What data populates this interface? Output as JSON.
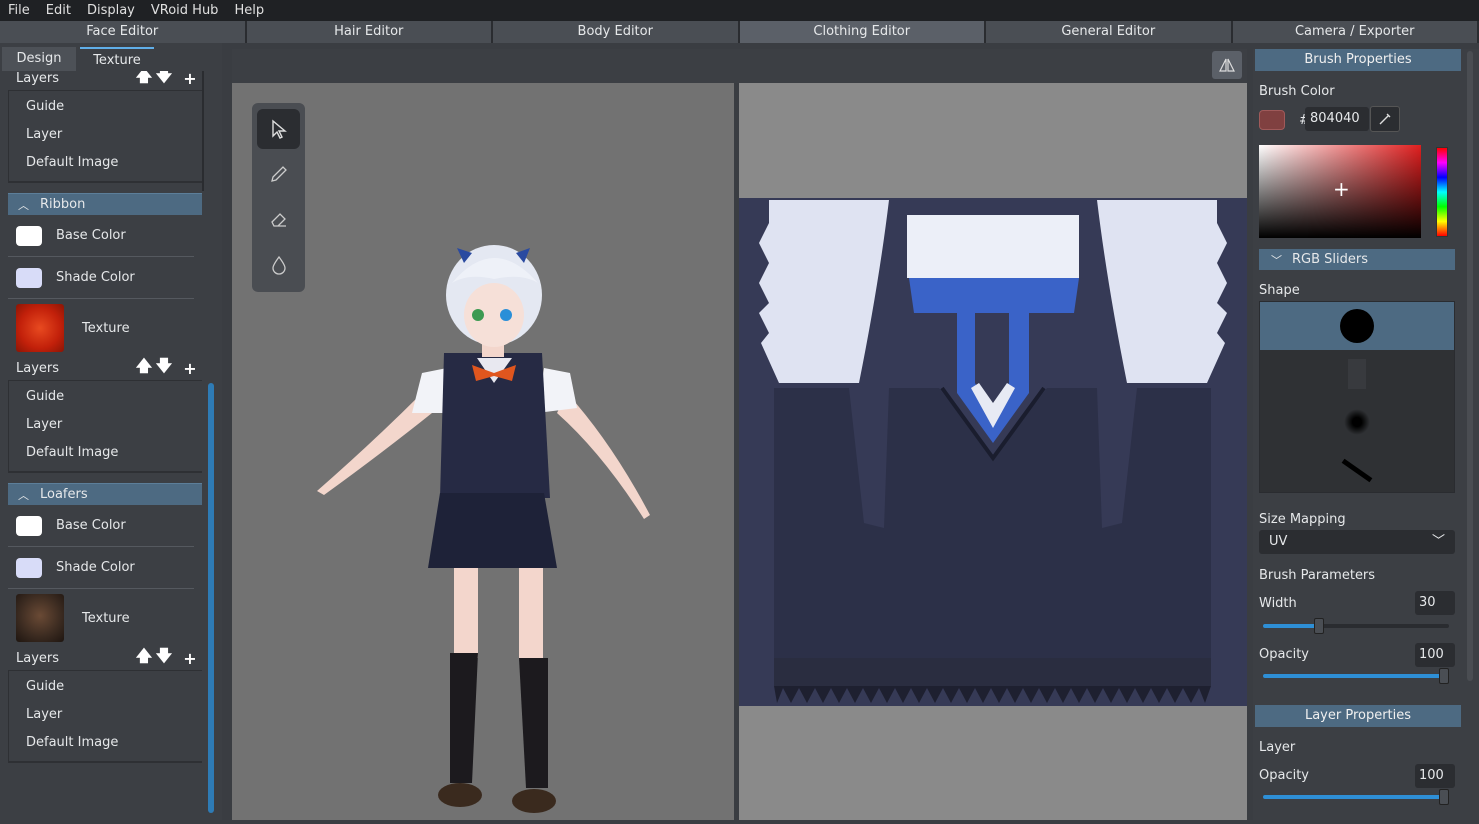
{
  "menu": [
    "File",
    "Edit",
    "Display",
    "VRoid Hub",
    "Help"
  ],
  "editor_tabs": [
    "Face Editor",
    "Hair Editor",
    "Body Editor",
    "Clothing Editor",
    "General Editor",
    "Camera / Exporter"
  ],
  "left": {
    "tabs": [
      "Design",
      "Texture"
    ],
    "layers_label": "Layers",
    "layer_items": [
      "Guide",
      "Layer",
      "Default Image"
    ],
    "sections": [
      {
        "title": "Ribbon",
        "base_color": "Base Color",
        "shade_color": "Shade Color",
        "texture": "Texture"
      },
      {
        "title": "Loafers",
        "base_color": "Base Color",
        "shade_color": "Shade Color",
        "texture": "Texture"
      }
    ]
  },
  "brush": {
    "header": "Brush Properties",
    "color_label": "Brush Color",
    "hash": "#",
    "hex": "804040",
    "color": "#804040",
    "rgb_sliders": "RGB Sliders",
    "shape_label": "Shape",
    "size_mapping_label": "Size Mapping",
    "size_mapping_value": "UV",
    "params_label": "Brush Parameters",
    "width_label": "Width",
    "width_value": "30",
    "width_fraction": 0.3,
    "opacity_label": "Opacity",
    "opacity_value": "100",
    "opacity_fraction": 1.0
  },
  "layer_props": {
    "header": "Layer Properties",
    "layer_label": "Layer",
    "opacity_label": "Opacity",
    "opacity_value": "100",
    "opacity_fraction": 1.0
  },
  "icons": [
    "cursor-icon",
    "pencil-icon",
    "eraser-icon",
    "fill-drop-icon",
    "eyedropper-icon",
    "mirror-icon",
    "arrow-up-icon",
    "arrow-down-icon",
    "plus-icon",
    "chevron-up-icon",
    "chevron-down-icon"
  ]
}
